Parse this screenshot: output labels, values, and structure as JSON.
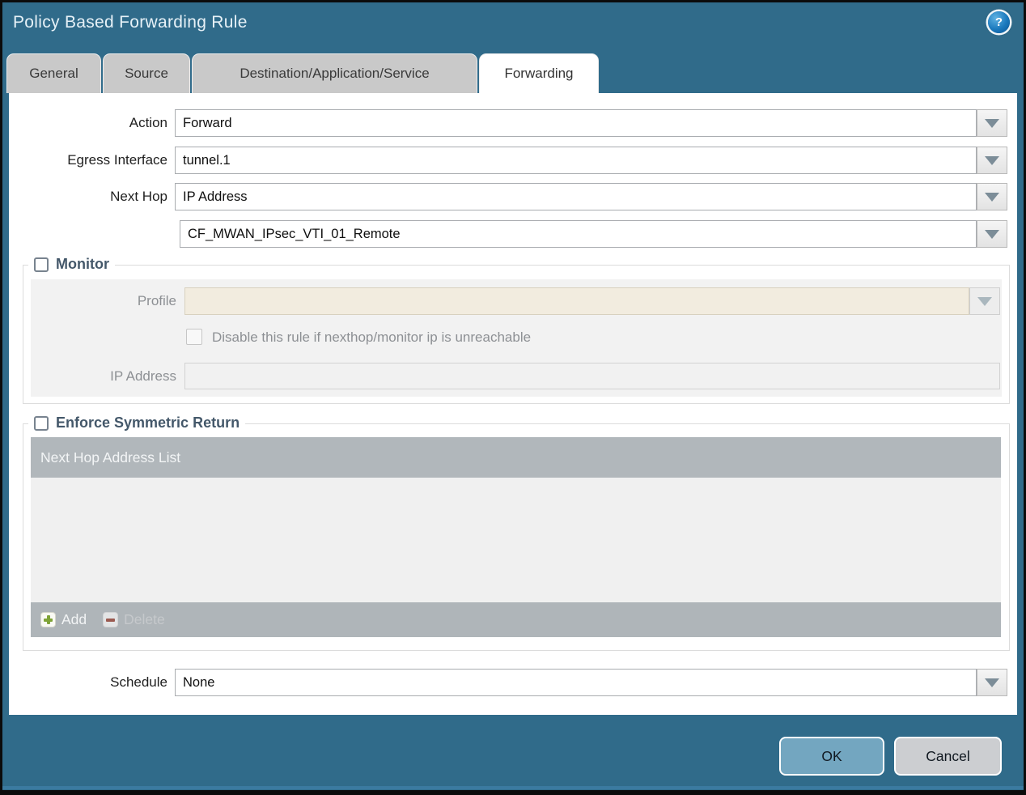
{
  "dialog": {
    "title": "Policy Based Forwarding Rule",
    "help_glyph": "?"
  },
  "tabs": [
    {
      "label": "General",
      "active": false
    },
    {
      "label": "Source",
      "active": false
    },
    {
      "label": "Destination/Application/Service",
      "active": false
    },
    {
      "label": "Forwarding",
      "active": true
    }
  ],
  "form": {
    "action": {
      "label": "Action",
      "value": "Forward"
    },
    "egress_interface": {
      "label": "Egress Interface",
      "value": "tunnel.1"
    },
    "next_hop": {
      "label": "Next Hop",
      "value": "IP Address"
    },
    "next_hop_address": {
      "value": "CF_MWAN_IPsec_VTI_01_Remote"
    },
    "schedule": {
      "label": "Schedule",
      "value": "None"
    }
  },
  "monitor": {
    "legend": "Monitor",
    "checked": false,
    "profile": {
      "label": "Profile",
      "value": "",
      "placeholder": ""
    },
    "disable_rule_label": "Disable this rule if nexthop/monitor ip is unreachable",
    "disable_rule_checked": false,
    "ip_address": {
      "label": "IP Address",
      "value": ""
    }
  },
  "symmetric_return": {
    "legend": "Enforce Symmetric Return",
    "checked": false,
    "table": {
      "header": "Next Hop Address List",
      "rows": []
    },
    "add_label": "Add",
    "delete_label": "Delete"
  },
  "footer": {
    "ok_label": "OK",
    "cancel_label": "Cancel"
  },
  "colors": {
    "titlebar_teal": "#306b8a",
    "active_tab_bg": "#ffffff",
    "inactive_tab_bg": "#c9c9c9",
    "disabled_field_beige": "#f2ecdf",
    "table_header_gray": "#b1b7bb",
    "add_icon_green": "#7fa337",
    "delete_icon_brown": "#9b5a50",
    "ok_button_blue": "#73a6c0",
    "cancel_button_gray": "#ccced1"
  }
}
